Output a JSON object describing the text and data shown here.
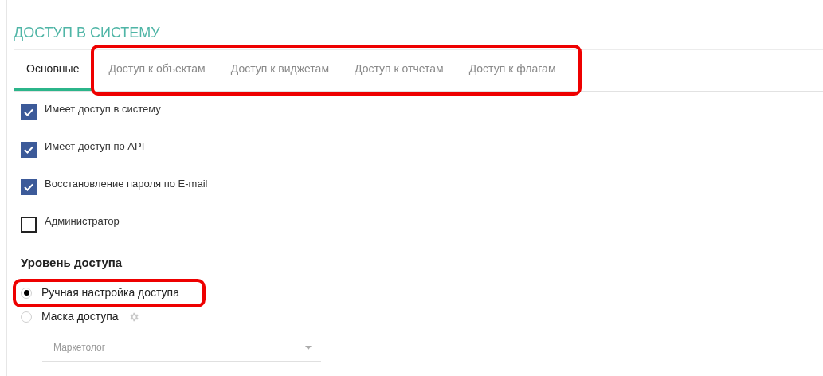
{
  "title": "ДОСТУП В СИСТЕМУ",
  "tabs": [
    {
      "label": "Основные",
      "selected": true,
      "highlighted": false
    },
    {
      "label": "Доступ к объектам",
      "selected": false,
      "highlighted": true
    },
    {
      "label": "Доступ к виджетам",
      "selected": false,
      "highlighted": true
    },
    {
      "label": "Доступ к отчетам",
      "selected": false,
      "highlighted": true
    },
    {
      "label": "Доступ к флагам",
      "selected": false,
      "highlighted": true
    }
  ],
  "checkboxes": [
    {
      "label": "Имеет доступ в систему",
      "checked": true
    },
    {
      "label": "Имеет доступ по API",
      "checked": true
    },
    {
      "label": "Восстановление пароля по E-mail",
      "checked": true
    },
    {
      "label": "Администратор",
      "checked": false
    }
  ],
  "access_level": {
    "heading": "Уровень доступа",
    "options": [
      {
        "label": "Ручная настройка доступа",
        "selected": true,
        "highlighted": true,
        "has_settings": false
      },
      {
        "label": "Маска доступа",
        "selected": false,
        "highlighted": false,
        "has_settings": true
      }
    ],
    "mask_select": {
      "value": "Маркетолог"
    }
  }
}
